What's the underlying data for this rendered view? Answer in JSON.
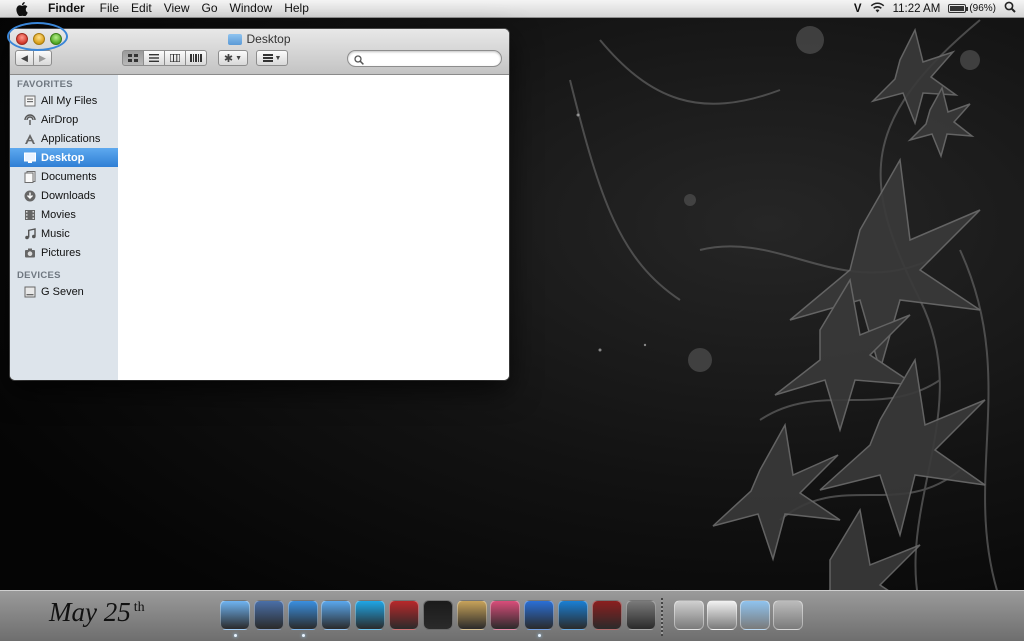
{
  "menubar": {
    "app_name": "Finder",
    "menus": [
      "File",
      "Edit",
      "View",
      "Go",
      "Window",
      "Help"
    ],
    "user_initial": "V",
    "time": "11:22 AM",
    "battery_percent": "(96%)",
    "battery_level": 0.96
  },
  "finder": {
    "title": "Desktop",
    "sidebar": {
      "favorites_header": "FAVORITES",
      "devices_header": "DEVICES",
      "favorites": [
        {
          "label": "All My Files",
          "icon": "all-files-icon"
        },
        {
          "label": "AirDrop",
          "icon": "airdrop-icon"
        },
        {
          "label": "Applications",
          "icon": "applications-icon"
        },
        {
          "label": "Desktop",
          "icon": "desktop-icon",
          "selected": true
        },
        {
          "label": "Documents",
          "icon": "documents-icon"
        },
        {
          "label": "Downloads",
          "icon": "downloads-icon"
        },
        {
          "label": "Movies",
          "icon": "movies-icon"
        },
        {
          "label": "Music",
          "icon": "music-icon"
        },
        {
          "label": "Pictures",
          "icon": "pictures-icon"
        }
      ],
      "devices": [
        {
          "label": "G Seven",
          "icon": "hard-drive-icon"
        }
      ]
    }
  },
  "desktop": {
    "date_text": "May 25",
    "date_suffix": "th"
  },
  "dock": {
    "apps": [
      {
        "name": "finder",
        "color": "#6fb4f2",
        "running": true
      },
      {
        "name": "mail",
        "color": "#4a6fa8",
        "running": false
      },
      {
        "name": "safari",
        "color": "#3a8fe0",
        "running": true
      },
      {
        "name": "messages",
        "color": "#5aa8ee",
        "running": false
      },
      {
        "name": "skype",
        "color": "#1fa6e6",
        "running": false
      },
      {
        "name": "dictionary",
        "color": "#b8282a",
        "running": false
      },
      {
        "name": "kindle",
        "color": "#1b1b1b",
        "running": false
      },
      {
        "name": "address-book",
        "color": "#c8a35a",
        "running": false
      },
      {
        "name": "photo-app",
        "color": "#d94d7a",
        "running": false
      },
      {
        "name": "itunes",
        "color": "#2a6fd6",
        "running": true
      },
      {
        "name": "teamviewer",
        "color": "#1a7fd4",
        "running": false
      },
      {
        "name": "mountain-app",
        "color": "#8b1f1f",
        "running": false
      },
      {
        "name": "automator",
        "color": "#7a7a7a",
        "running": false
      }
    ],
    "right_items": [
      {
        "name": "system-apple",
        "color": "#d0d0d0"
      },
      {
        "name": "documents-stack",
        "color": "#f2f2f2"
      },
      {
        "name": "downloads-stack",
        "color": "#8fc3ef"
      },
      {
        "name": "trash",
        "color": "#bcbcbc"
      }
    ]
  }
}
